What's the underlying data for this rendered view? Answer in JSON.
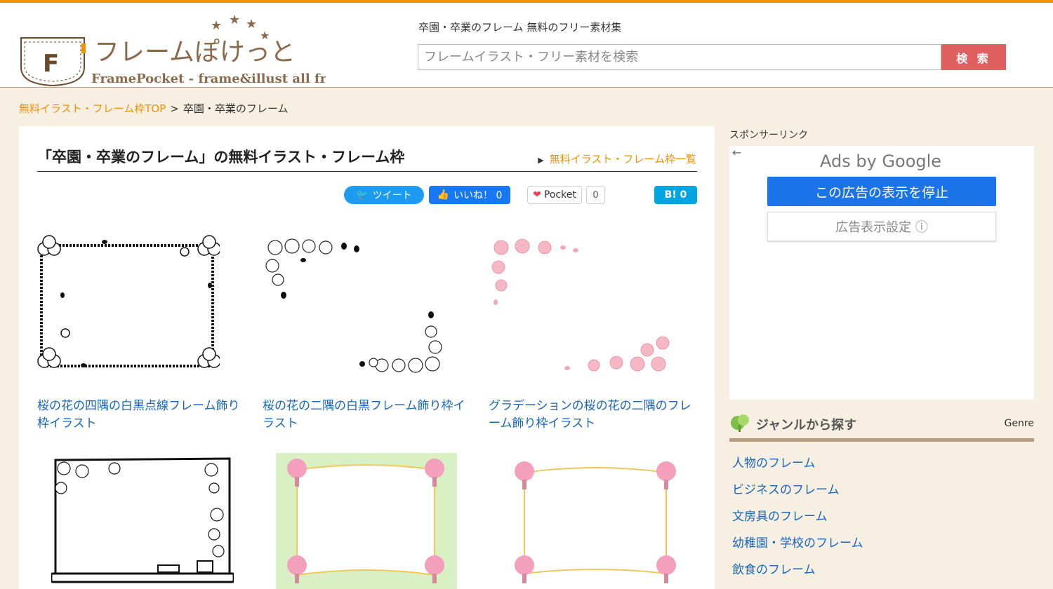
{
  "site": {
    "logo_text": "フレームぽけっと",
    "logo_sub": "FramePocket - frame&illust all free",
    "logo_letter": "F",
    "tagline": "卒園・卒業のフレーム 無料のフリー素材集"
  },
  "search": {
    "placeholder": "フレームイラスト・フリー素材を検索",
    "button": "検 索"
  },
  "breadcrumb": {
    "home": "無料イラスト・フレーム枠TOP",
    "separator": ">",
    "current": "卒園・卒業のフレーム"
  },
  "main": {
    "title": "「卒園・卒業のフレーム」の無料イラスト・フレーム枠",
    "list_link": "無料イラスト・フレーム枠一覧",
    "share": {
      "tweet": "ツイート",
      "like": "いいね！ 0",
      "pocket": "Pocket",
      "pocket_count": "0",
      "hatena": "B! 0"
    },
    "cards": [
      {
        "caption": "桜の花の四隅の白黒点線フレーム飾り枠イラスト"
      },
      {
        "caption": "桜の花の二隅の白黒フレーム飾り枠イラスト"
      },
      {
        "caption": "グラデーションの桜の花の二隅のフレーム飾り枠イラスト"
      }
    ]
  },
  "sidebar": {
    "sponsor": "スポンサーリンク",
    "ads_by": "Ads by Google",
    "stop_ad": "この広告の表示を停止",
    "ad_settings": "広告表示設定 ⓘ",
    "genre_title": "ジャンルから探す",
    "genre_en": "Genre",
    "genres": [
      "人物のフレーム",
      "ビジネスのフレーム",
      "文房具のフレーム",
      "幼稚園・学校のフレーム",
      "飲食のフレーム"
    ]
  },
  "colors": {
    "accent": "#f39100",
    "link": "#1565c0",
    "search_button": "#e05f5f",
    "background": "#f8efe3"
  }
}
